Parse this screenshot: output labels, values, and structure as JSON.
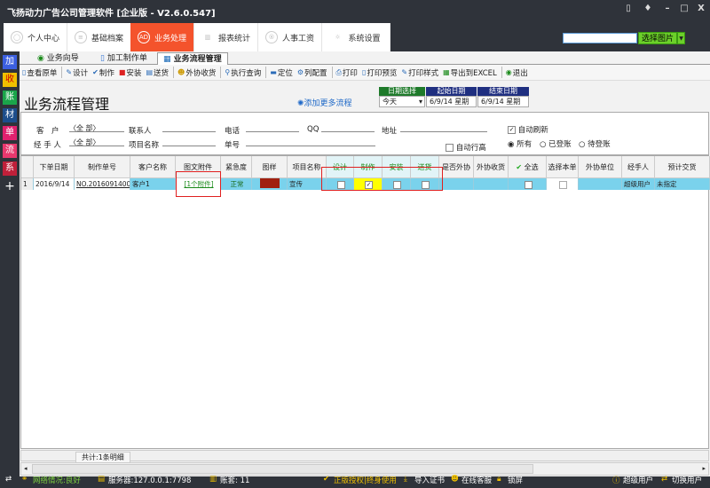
{
  "app": {
    "title": "飞扬动力广告公司管理软件 [企业版 - V2.6.0.547]",
    "window_buttons": [
      "trash-icon",
      "shirt-icon",
      "minimize-icon",
      "maximize-icon",
      "close-icon"
    ],
    "close": "X"
  },
  "nav": {
    "tabs": [
      {
        "label": "个人中心",
        "icon": "user-icon"
      },
      {
        "label": "基础档案",
        "icon": "list-icon"
      },
      {
        "label": "业务处理",
        "icon": "AD",
        "active": true
      },
      {
        "label": "报表统计",
        "icon": "chart-icon"
      },
      {
        "label": "人事工资",
        "icon": "person-icon"
      },
      {
        "label": "系统设置",
        "icon": "gear-icon"
      }
    ],
    "image_search_value": "",
    "image_button": "选择图片"
  },
  "sidebar": [
    {
      "label": "加",
      "color": "#3b5fe0"
    },
    {
      "label": "收",
      "color": "#f0c000"
    },
    {
      "label": "账",
      "color": "#1aa54a"
    },
    {
      "label": "材",
      "color": "#1d4e8c"
    },
    {
      "label": "单",
      "color": "#e0206e"
    },
    {
      "label": "流",
      "color": "#e8386e"
    },
    {
      "label": "系",
      "color": "#c0203a"
    },
    {
      "label": "+",
      "color": "#2f333a"
    }
  ],
  "subtabs": [
    {
      "label": "业务向导"
    },
    {
      "label": "加工制作单"
    },
    {
      "label": "业务流程管理",
      "active": true
    }
  ],
  "toolbar": [
    "查看原单",
    "设计",
    "制作",
    "安装",
    "送货",
    "外协收货",
    "执行查询",
    "定位",
    "列配置",
    "打印",
    "打印预览",
    "打印样式",
    "导出到EXCEL",
    "退出"
  ],
  "page": {
    "title": "业务流程管理",
    "add_flow": "添加更多流程"
  },
  "dates": {
    "h1": "日期选择",
    "h2": "起始日期",
    "h3": "结束日期",
    "v1": "今天",
    "v2": "6/9/14 星期",
    "v3": "6/9/14 星期"
  },
  "filter": {
    "customer_label": "客　户",
    "customer_value": "〈全 部〉",
    "handler_label": "经 手 人",
    "handler_value": "〈全 部〉",
    "contact": "联系人",
    "project": "项目名称",
    "phone": "电话",
    "order_no": "单号",
    "qq": "QQ",
    "address": "地址",
    "auto_row_height": "自动行高",
    "auto_refresh": "自动刷新",
    "auto_refresh_checked": true,
    "radios": [
      "所有",
      "已登账",
      "待登账"
    ],
    "radio_selected": "所有"
  },
  "grid": {
    "columns": [
      "",
      "下单日期",
      "制作单号",
      "客户名称",
      "图文附件",
      "紧急度",
      "图样",
      "项目名称",
      "设计",
      "制作",
      "安装",
      "送货",
      "是否外协",
      "外协收货",
      "全选",
      "选择本单",
      "外协单位",
      "经手人",
      "预计交货"
    ],
    "rows": [
      {
        "n": "1",
        "date": "2016/9/14",
        "no": "NO.201609140001",
        "customer": "客户1",
        "attach": "[1个附件]",
        "urgency": "正常",
        "project": "宣传",
        "design": false,
        "make": true,
        "install": false,
        "deliver": false,
        "handler": "超级用户",
        "delivery": "未指定"
      }
    ],
    "summary": "共计:1条明细"
  },
  "status": {
    "network": "网络情况:良好",
    "server": "服务器:127.0.0.1:7798",
    "account": "账套: 11",
    "license": "正版授权|终身使用",
    "import": "导入证书",
    "service": "在线客服",
    "lock": "锁屏",
    "user": "超级用户",
    "switch": "切换用户"
  }
}
